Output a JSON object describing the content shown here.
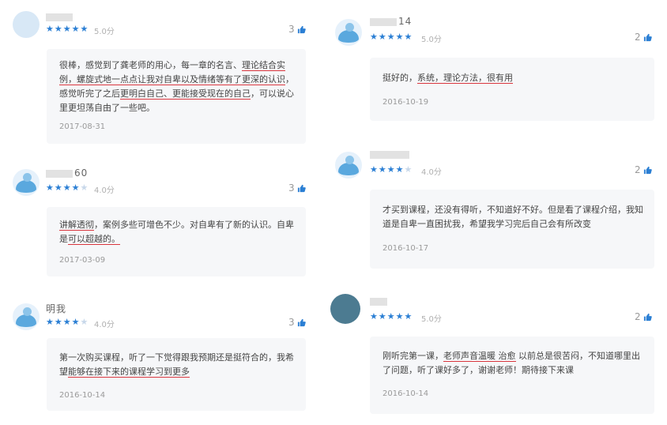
{
  "reviews": [
    {
      "user": "",
      "rating_text": "5.0分",
      "rating": 5,
      "likes": "3",
      "text_parts": [
        {
          "t": "很棒，感觉到了龚老师的用心，每一章的名言、",
          "u": false
        },
        {
          "t": "理论结合实例",
          "u": true
        },
        {
          "t": "，螺旋式地一点点让我对自卑以及情绪等有了更深的认识",
          "u": true
        },
        {
          "t": "，感觉听完了之后",
          "u": false
        },
        {
          "t": "更明白自己、更能接受现在的自己",
          "u": true
        },
        {
          "t": "，可以说心里更坦荡自由了一些吧。",
          "u": false
        }
      ],
      "date": "2017-08-31"
    },
    {
      "user": "60",
      "rating_text": "4.0分",
      "rating": 4,
      "likes": "3",
      "text_parts": [
        {
          "t": "讲解透彻",
          "u": true
        },
        {
          "t": "，案例多些可增色不少。对自卑有了新的认识。自卑是",
          "u": false
        },
        {
          "t": "可以超越的。",
          "u": true
        }
      ],
      "date": "2017-03-09"
    },
    {
      "user": "明我",
      "rating_text": "4.0分",
      "rating": 4,
      "likes": "3",
      "text_parts": [
        {
          "t": "第一次购买课程，听了一下觉得跟我预期还是挺符合的，我希望",
          "u": false
        },
        {
          "t": "能够在接下来的课程学习到更多",
          "u": true
        }
      ],
      "date": "2016-10-14"
    },
    {
      "user": "14",
      "rating_text": "5.0分",
      "rating": 5,
      "likes": "2",
      "text_parts": [
        {
          "t": "挺好的，",
          "u": false
        },
        {
          "t": "系统，理论方法，很有用",
          "u": true
        }
      ],
      "date": "2016-10-19"
    },
    {
      "user": "",
      "rating_text": "4.0分",
      "rating": 4,
      "likes": "2",
      "text_parts": [
        {
          "t": "才买到课程，还没有得听，不知道好不好。但是看了课程介绍，我知道是自卑一直困扰我，希望我学习完后自己会有所改变",
          "u": false
        }
      ],
      "date": "2016-10-17"
    },
    {
      "user": "",
      "rating_text": "5.0分",
      "rating": 5,
      "likes": "2",
      "text_parts": [
        {
          "t": "刚听完第一课，",
          "u": false
        },
        {
          "t": "老师声音温暖 治愈",
          "u": true
        },
        {
          "t": " 以前总是很苦闷，不知道哪里出了问题，听了课好多了，谢谢老师！期待接下来课",
          "u": false
        }
      ],
      "date": "2016-10-14"
    }
  ],
  "colors": {
    "star": "#2b7fd4",
    "underline": "#d9363e",
    "bubble": "#f6f7f9"
  },
  "icons": {
    "like": "thumbs-up-icon",
    "star": "star-icon"
  }
}
